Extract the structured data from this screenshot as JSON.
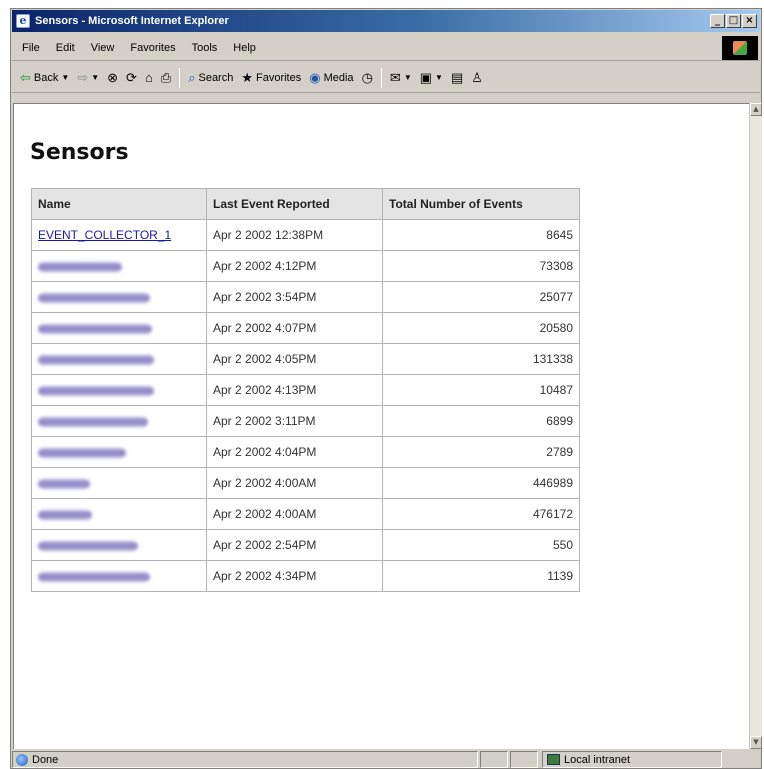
{
  "window": {
    "title": "Sensors - Microsoft Internet Explorer",
    "controls": {
      "minimize": "_",
      "maximize": "□",
      "close": "×"
    }
  },
  "menu": [
    "File",
    "Edit",
    "View",
    "Favorites",
    "Tools",
    "Help"
  ],
  "toolbar": {
    "back": "Back",
    "search": "Search",
    "favorites": "Favorites",
    "media": "Media"
  },
  "page": {
    "title": "Sensors",
    "columns": [
      "Name",
      "Last Event Reported",
      "Total Number of Events"
    ],
    "rows": [
      {
        "name": "EVENT_COLLECTOR_1",
        "last_event": "Apr 2 2002 12:38PM",
        "total": "8645"
      },
      {
        "name": "",
        "last_event": "Apr 2 2002 4:12PM",
        "total": "73308"
      },
      {
        "name": "",
        "last_event": "Apr 2 2002 3:54PM",
        "total": "25077"
      },
      {
        "name": "",
        "last_event": "Apr 2 2002 4:07PM",
        "total": "20580"
      },
      {
        "name": "",
        "last_event": "Apr 2 2002 4:05PM",
        "total": "131338"
      },
      {
        "name": "",
        "last_event": "Apr 2 2002 4:13PM",
        "total": "10487"
      },
      {
        "name": "",
        "last_event": "Apr 2 2002 3:11PM",
        "total": "6899"
      },
      {
        "name": "",
        "last_event": "Apr 2 2002 4:04PM",
        "total": "2789"
      },
      {
        "name": "",
        "last_event": "Apr 2 2002 4:00AM",
        "total": "446989"
      },
      {
        "name": "",
        "last_event": "Apr 2 2002 4:00AM",
        "total": "476172"
      },
      {
        "name": "",
        "last_event": "Apr 2 2002 2:54PM",
        "total": "550"
      },
      {
        "name": "",
        "last_event": "Apr 2 2002 4:34PM",
        "total": "1139"
      }
    ]
  },
  "status": {
    "text": "Done",
    "zone": "Local intranet"
  },
  "colors": {
    "title_bar_start": "#0a246a",
    "link": "#1a1aa8",
    "table_border": "#b4b4b4",
    "header_bg": "#e4e4e4"
  }
}
